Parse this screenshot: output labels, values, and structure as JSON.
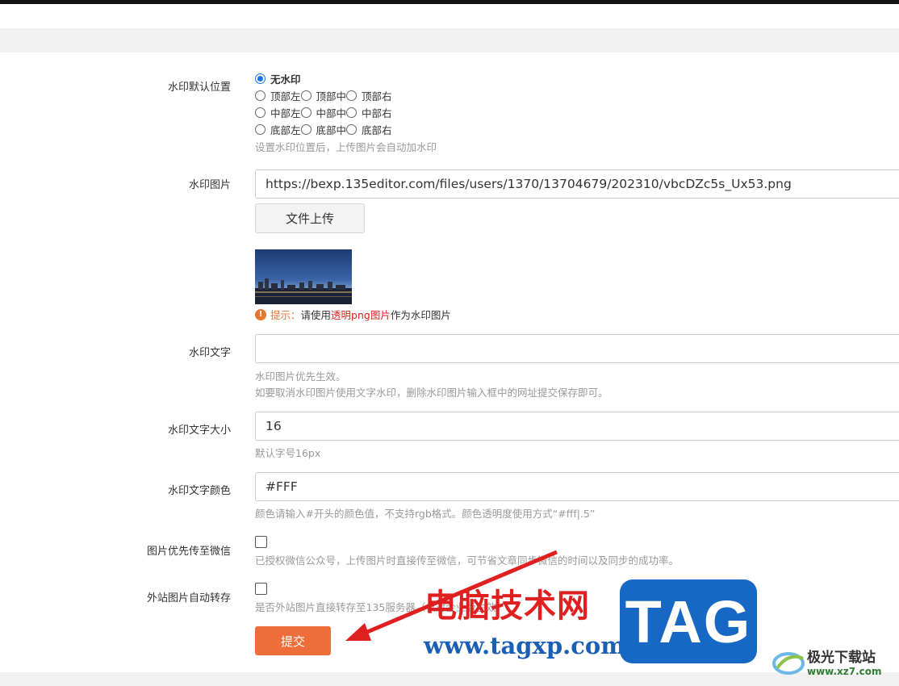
{
  "colors": {
    "accent_blue": "#1a73e8",
    "submit_orange": "#ee6e3b",
    "tip_orange": "#e8772e",
    "tip_red": "#e02020",
    "help_gray": "#999999"
  },
  "watermark_position": {
    "label": "水印默认位置",
    "options": [
      [
        "无水印"
      ],
      [
        "顶部左",
        "顶部中",
        "顶部右"
      ],
      [
        "中部左",
        "中部中",
        "中部右"
      ],
      [
        "底部左",
        "底部中",
        "底部右"
      ]
    ],
    "selected": "无水印",
    "help": "设置水印位置后，上传图片会自动加水印"
  },
  "watermark_image": {
    "label": "水印图片",
    "value": "https://bexp.135editor.com/files/users/1370/13704679/202310/vbcDZc5s_Ux53.png",
    "upload_label": "文件上传",
    "tip_icon": "exclamation-icon",
    "tip_prefix": "提示：",
    "tip_text1": "请使用",
    "tip_highlight": "透明png图片",
    "tip_text2": "作为水印图片"
  },
  "watermark_text": {
    "label": "水印文字",
    "value": "",
    "help1": "水印图片优先生效。",
    "help2": "如要取消水印图片使用文字水印，删除水印图片输入框中的网址提交保存即可。"
  },
  "watermark_text_size": {
    "label": "水印文字大小",
    "value": "16",
    "help": "默认字号16px"
  },
  "watermark_text_color": {
    "label": "水印文字颜色",
    "value": "#FFF",
    "help": "颜色请输入#开头的颜色值，不支持rgb格式。颜色透明度使用方式“#fff|.5”"
  },
  "prefer_wechat": {
    "label": "图片优先传至微信",
    "checked": false,
    "help": "已授权微信公众号，上传图片时直接传至微信，可节省文章同步微信的时间以及同步的成功率。"
  },
  "auto_transfer": {
    "label": "外站图片自动转存",
    "checked": false,
    "help": "是否外站图片直接转存至135服务器（仅对企业版生效"
  },
  "submit_label": "提交",
  "overlay": {
    "cn_text": "电脑技术网",
    "url_text": "www.tagxp.com",
    "tag_text": "TAG",
    "logo_cn": "极光下载站",
    "logo_url": "www.xz7.com"
  }
}
